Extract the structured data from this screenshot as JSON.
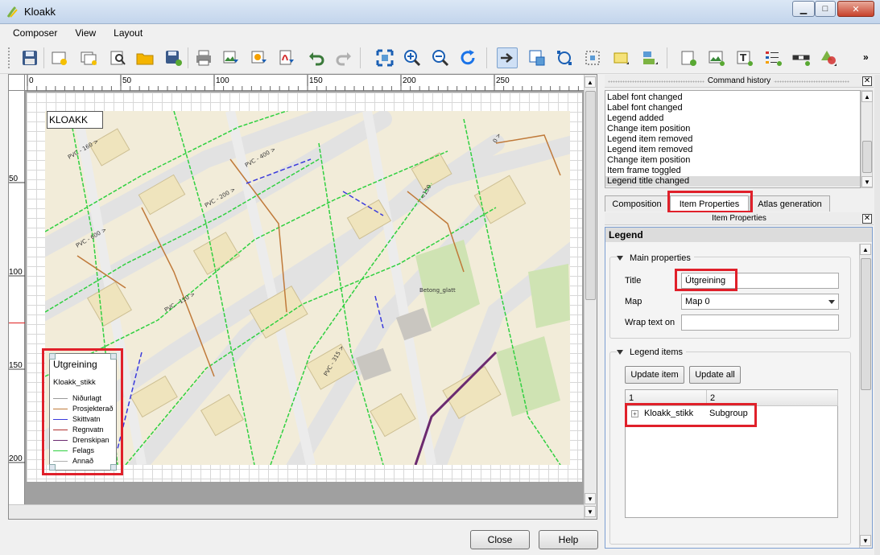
{
  "window": {
    "title": "Kloakk",
    "minimize": "▁",
    "maximize": "□",
    "close": "✕"
  },
  "menu": [
    "Composer",
    "View",
    "Layout"
  ],
  "toolbar": {
    "icons": [
      "save-icon",
      "new-composer-icon",
      "duplicate-composer-icon",
      "composer-manager-icon",
      "open-template-icon",
      "save-template-icon",
      "print-icon",
      "export-image-icon",
      "export-svg-icon",
      "export-pdf-icon",
      "undo-icon",
      "redo-icon",
      "zoom-full-icon",
      "zoom-in-icon",
      "zoom-out-icon",
      "refresh-icon",
      "select-move-icon",
      "move-content-icon",
      "edit-nodes-icon",
      "select-area-icon",
      "group-icon",
      "align-icon",
      "add-map-icon",
      "add-image-icon",
      "add-label-icon",
      "add-legend-icon",
      "add-scalebar-icon",
      "add-shape-icon"
    ],
    "more": "»"
  },
  "ruler": {
    "h_ticks": [
      "0",
      "50",
      "100",
      "150",
      "200",
      "250"
    ],
    "v_ticks": [
      "50",
      "100",
      "150",
      "200"
    ]
  },
  "composition": {
    "map_label": "KLOAKK",
    "legend": {
      "title": "Utgreining",
      "group": "Kloakk_stikk",
      "entries": [
        "Niðurlagt",
        "Prosjekterað",
        "Skittvatn",
        "Regnvatn",
        "Drenskipan",
        "Felags",
        "Annað"
      ],
      "colors": [
        "#9a9a9a",
        "#c07a3a",
        "#3a3adc",
        "#b03030",
        "#6b2a70",
        "#30d040",
        "#b0b0b0"
      ]
    },
    "map_labels": [
      "PVC - 160 >",
      "PVC - 400 >",
      "PVC - 110 >",
      "PVC - 200 >",
      "PVC - 600 >",
      "PVC - 315 >",
      "Betong_glatt",
      "<150",
      "0 >"
    ]
  },
  "buttons": {
    "close": "Close",
    "help": "Help"
  },
  "command_history": {
    "title": "Command history",
    "items": [
      "Label font changed",
      "Label font changed",
      "Legend added",
      "Change item position",
      "Legend item removed",
      "Legend item removed",
      "Change item position",
      "Item frame toggled",
      "Legend title changed"
    ],
    "selected_index": 8
  },
  "tabs": [
    "Composition",
    "Item Properties",
    "Atlas generation"
  ],
  "active_tab": 1,
  "item_properties": {
    "dock_title": "Item Properties",
    "heading": "Legend",
    "main_properties": "Main properties",
    "title_label": "Title",
    "title_value": "Útgreining",
    "map_label": "Map",
    "map_value": "Map 0",
    "wrap_label": "Wrap text on",
    "wrap_value": "",
    "legend_items": "Legend items",
    "update_item": "Update item",
    "update_all": "Update all",
    "col1": "1",
    "col2": "2",
    "row_name": "Kloakk_stikk",
    "row_value": "Subgroup"
  }
}
